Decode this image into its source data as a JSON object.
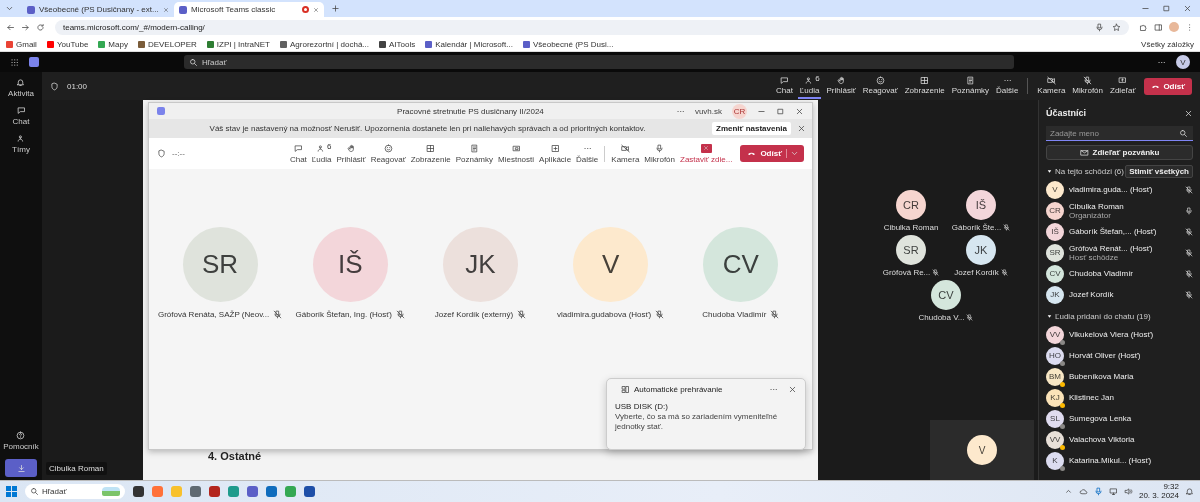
{
  "browser": {
    "tabs": [
      {
        "title": "Všeobecné (PS Dusičnany - ext...",
        "selected": false,
        "recording": false
      },
      {
        "title": "Microsoft Teams classic",
        "selected": true,
        "recording": true
      }
    ],
    "url": "teams.microsoft.com/_#/modern-calling/",
    "bookmarks": [
      "Gmail",
      "YouTube",
      "Mapy",
      "DEVELOPER",
      "IZPI | IntraNET",
      "Agrorezortní | dochá...",
      "AITools",
      "Kalendár | Microsoft...",
      "Všeobecné (PS Dusi..."
    ],
    "all_bookmarks": "Všetky záložky"
  },
  "teams": {
    "search": {
      "placeholder": "Hľadať"
    },
    "avatar": "V",
    "rail": [
      {
        "label": "Aktivita"
      },
      {
        "label": "Chat"
      },
      {
        "label": "Tímy"
      }
    ],
    "help": "Pomocník",
    "timer": "01:00",
    "toolbar": [
      {
        "label": "Chat",
        "selected": false
      },
      {
        "label": "Ľudia",
        "selected": true,
        "count": "6"
      },
      {
        "label": "Prihlásiť",
        "selected": false
      },
      {
        "label": "Reagovať",
        "selected": false
      },
      {
        "label": "Zobrazenie",
        "selected": false
      },
      {
        "label": "Poznámky",
        "selected": false
      },
      {
        "label": "Ďalšie",
        "selected": false
      }
    ],
    "devices": [
      {
        "label": "Kamera",
        "kind": "camera-off"
      },
      {
        "label": "Mikrofón",
        "kind": "mic-off"
      },
      {
        "label": "Zdieľať",
        "kind": "share"
      }
    ],
    "leave_button": "Odísť"
  },
  "shared_screen": {
    "window_title": "Pracovné stretnutie PS dusičnany II/2024",
    "org": "vuvh.sk",
    "org_avatar": "CR",
    "banner": {
      "text": "Váš stav je nastavený na možnosť Nerušiť. Upozornenia dostanete len pri naliehavých správach a od prioritných kontaktov.",
      "button": "Zmeniť nastavenia"
    },
    "timer": "--:--",
    "toolbar": [
      {
        "label": "Chat"
      },
      {
        "label": "Ľudia",
        "count": "6"
      },
      {
        "label": "Prihlásiť"
      },
      {
        "label": "Reagovať"
      },
      {
        "label": "Zobrazenie"
      },
      {
        "label": "Poznámky"
      },
      {
        "label": "Miestnosti"
      },
      {
        "label": "Aplikácie"
      },
      {
        "label": "Ďalšie"
      }
    ],
    "devices": [
      {
        "label": "Kamera",
        "kind": "camera-off"
      },
      {
        "label": "Mikrofón",
        "kind": "mic"
      },
      {
        "label": "Zastaviť zdie...",
        "kind": "stop-share"
      }
    ],
    "leave_button": "Odísť",
    "participants": [
      {
        "name": "Grófová Renáta, SAŽP (Neov...",
        "muted": true,
        "avatar": {
          "initials": "SR",
          "color": "#dfe3dc"
        }
      },
      {
        "name": "Gáborík Štefan, Ing. (Hosť)",
        "muted": true,
        "avatar": {
          "initials": "IŠ",
          "color": "#f3d6da"
        }
      },
      {
        "name": "Jozef Kordík (externý)",
        "muted": true,
        "avatar": {
          "initials": "JK",
          "color": "#ece0dc"
        }
      },
      {
        "name": "vladimira.gudabova (Hosť)",
        "muted": true,
        "avatar": {
          "initials": "V",
          "color": "#fde9cd"
        }
      },
      {
        "name": "Chudoba Vladimír",
        "muted": true,
        "avatar": {
          "initials": "CV",
          "color": "#d4e6dc"
        }
      }
    ],
    "document_text": "4.  Ostatné"
  },
  "gallery": [
    {
      "name": "Cibulka Roman",
      "muted": false,
      "avatar": {
        "initials": "CR",
        "color": "#f6d5cf"
      }
    },
    {
      "name": "Gáborík Šte...",
      "muted": true,
      "avatar": {
        "initials": "IŠ",
        "color": "#f3d6da"
      }
    },
    {
      "name": "Grófová Re...",
      "muted": true,
      "avatar": {
        "initials": "SR",
        "color": "#dfe3dc"
      }
    },
    {
      "name": "Jozef Kordík",
      "muted": true,
      "avatar": {
        "initials": "JK",
        "color": "#d6e6f0"
      }
    },
    {
      "name": "Chudoba V...",
      "muted": true,
      "avatar": {
        "initials": "CV",
        "color": "#d4e6dc"
      }
    }
  ],
  "self_view": {
    "avatar": {
      "initials": "V",
      "color": "#fde9cd"
    }
  },
  "tooltip": "Cibulka Roman",
  "panel": {
    "title": "Účastníci",
    "search": {
      "placeholder": "Zadajte meno"
    },
    "invite_button": "Zdieľať pozvánku",
    "sections": [
      {
        "title": "Na tejto schôdzi (6)",
        "expanded": true,
        "action": "Stlmiť všetkých",
        "people": [
          {
            "name": "vladimira.guda...  (Hosť)",
            "muted": true,
            "avatar": {
              "initials": "V",
              "color": "#fde9cd"
            }
          },
          {
            "name": "Cibulka Roman",
            "role": "Organizátor",
            "muted": false,
            "avatar": {
              "initials": "CR",
              "color": "#f6d5cf"
            }
          },
          {
            "name": "Gáborík Štefan,...  (Hosť)",
            "muted": true,
            "avatar": {
              "initials": "IŠ",
              "color": "#f3d6da"
            }
          },
          {
            "name": "Grófová Renát...  (Hosť)",
            "role": "Hosť schôdze",
            "muted": true,
            "avatar": {
              "initials": "SR",
              "color": "#dfe3dc"
            }
          },
          {
            "name": "Chudoba Vladimír",
            "muted": true,
            "avatar": {
              "initials": "CV",
              "color": "#d4e6dc"
            }
          },
          {
            "name": "Jozef Kordík",
            "muted": true,
            "avatar": {
              "initials": "JK",
              "color": "#d6e6f0"
            }
          }
        ]
      },
      {
        "title": "Ľudia pridaní do chatu (19)",
        "expanded": true,
        "people": [
          {
            "name": "Vlkukelová Viera (Hosť)",
            "avatar": {
              "initials": "VV",
              "color": "#f3d6da"
            },
            "presence": {
              "color": "#8a8886"
            }
          },
          {
            "name": "Horvát Oliver (Hosť)",
            "avatar": {
              "initials": "HO",
              "color": "#dcdcf0"
            },
            "presence": {
              "color": "#8a8886"
            }
          },
          {
            "name": "Bubeníkova Maria",
            "avatar": {
              "initials": "BM",
              "color": "#f7e6c4"
            },
            "presence": {
              "color": "#fcb900"
            }
          },
          {
            "name": "Klistinec Jan",
            "avatar": {
              "initials": "KJ",
              "color": "#fbe3b8"
            },
            "presence": {
              "color": "#fcb900"
            }
          },
          {
            "name": "Sumegova Lenka",
            "avatar": {
              "initials": "SL",
              "color": "#e0dcf0"
            },
            "presence": {
              "color": "#8a8886"
            }
          },
          {
            "name": "Valachova Viktoria",
            "avatar": {
              "initials": "VV",
              "color": "#e8e0d8"
            },
            "presence": {
              "color": "#fcb900"
            }
          },
          {
            "name": "Katarina.Mikul...  (Hosť)",
            "avatar": {
              "initials": "K",
              "color": "#dcdcf0"
            },
            "presence": {
              "color": "#8a8886"
            }
          }
        ]
      }
    ]
  },
  "toast": {
    "title": "Automatické prehrávanie",
    "heading": "USB DISK (D:)",
    "body": "Vyberte, čo sa má so zariadením vymeniteľné jednotky stať."
  },
  "taskbar": {
    "search": {
      "placeholder": "Hľadať"
    },
    "time": "9:32",
    "date": "20. 3. 2024"
  }
}
